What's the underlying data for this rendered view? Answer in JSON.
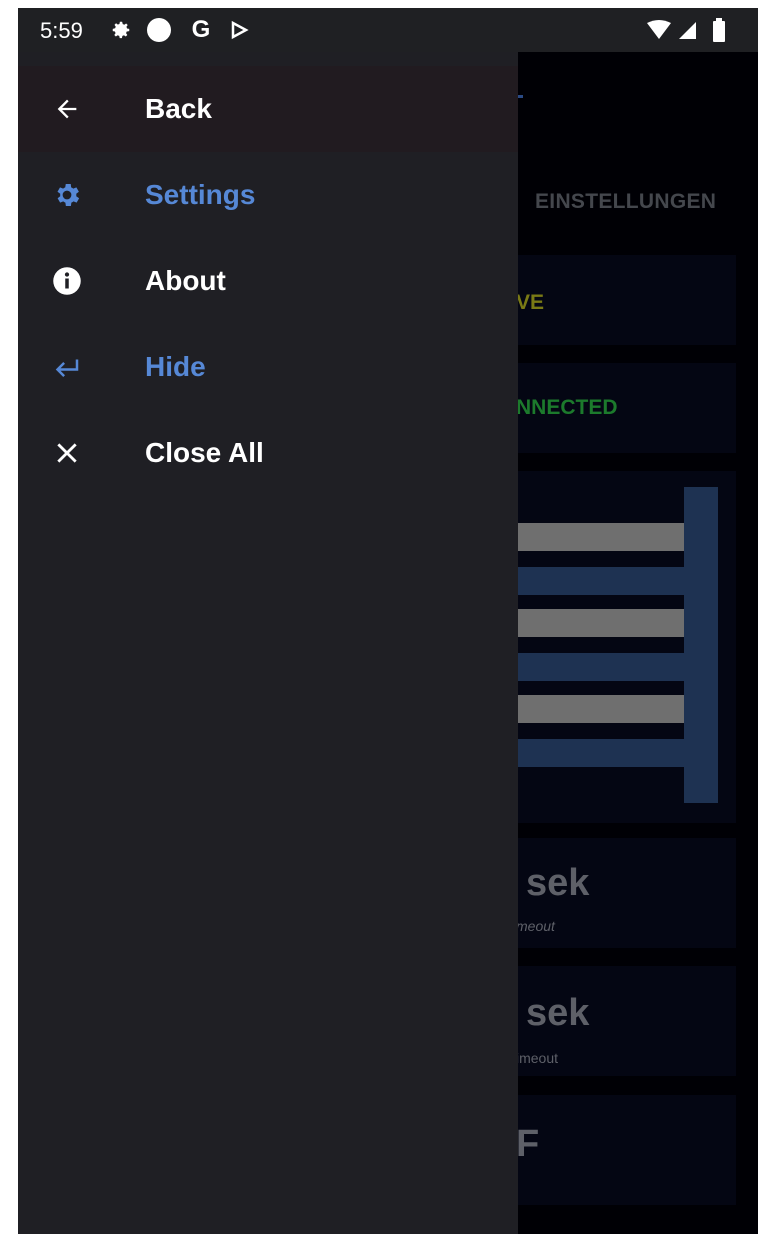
{
  "status_bar": {
    "time": "5:59",
    "icons": [
      "settings-icon",
      "circle-icon",
      "google-icon",
      "play-store-icon",
      "wifi-icon",
      "signal-icon",
      "battery-icon"
    ],
    "google_letter": "G"
  },
  "drawer": {
    "items": [
      {
        "label": "Back",
        "icon": "arrow-left-icon",
        "active": false
      },
      {
        "label": "Settings",
        "icon": "gear-icon",
        "active": true
      },
      {
        "label": "About",
        "icon": "info-icon",
        "active": false
      },
      {
        "label": "Hide",
        "icon": "return-arrow-icon",
        "active": true
      },
      {
        "label": "Close All",
        "icon": "close-icon",
        "active": false
      }
    ]
  },
  "background_app": {
    "tab_label": "EINSTELLUNGEN",
    "status_card_1": "VE",
    "status_card_2": "NNECTED",
    "timeout_card_1": {
      "value": "sek",
      "label": "meout"
    },
    "timeout_card_2": {
      "value": "sek",
      "label": "imeout"
    },
    "last_card_text": "F"
  },
  "colors": {
    "accent": "#5688d6",
    "drawer_bg": "#1f1f24",
    "back_row_bg": "#211b20",
    "status_yellow": "#7a7a15",
    "status_green": "#1c7a2c"
  }
}
